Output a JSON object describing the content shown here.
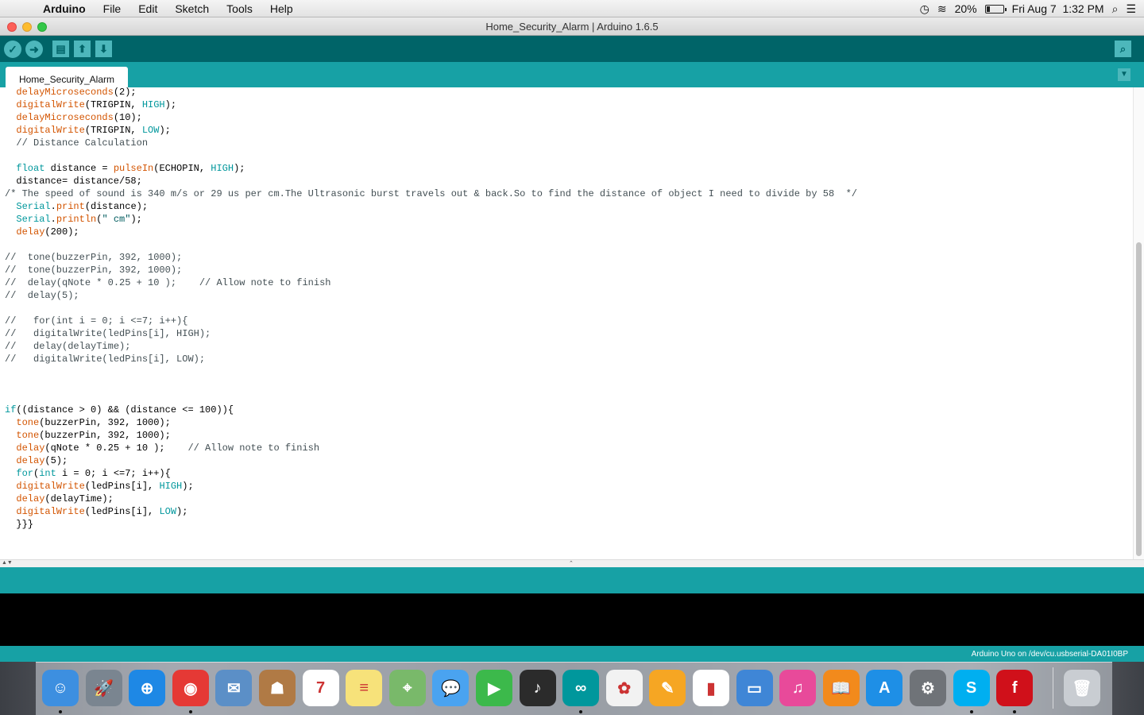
{
  "menubar": {
    "app_name": "Arduino",
    "items": [
      "File",
      "Edit",
      "Sketch",
      "Tools",
      "Help"
    ],
    "battery_percent_label": "20%",
    "battery_level": 0.2,
    "datetime": "Fri Aug 7  1:32 PM"
  },
  "window": {
    "title": "Home_Security_Alarm | Arduino 1.6.5"
  },
  "tab": {
    "label": "Home_Security_Alarm"
  },
  "code_lines": [
    [
      [
        "delayMicroseconds",
        "fn"
      ],
      [
        "(2);",
        ""
      ]
    ],
    [
      [
        "digitalWrite",
        "fn"
      ],
      [
        "(TRIGPIN, ",
        ""
      ],
      [
        "HIGH",
        "kw"
      ],
      [
        ");",
        ""
      ]
    ],
    [
      [
        "delayMicroseconds",
        "fn"
      ],
      [
        "(10);",
        ""
      ]
    ],
    [
      [
        "digitalWrite",
        "fn"
      ],
      [
        "(TRIGPIN, ",
        ""
      ],
      [
        "LOW",
        "kw"
      ],
      [
        ");",
        ""
      ]
    ],
    [
      [
        "// Distance Calculation",
        "cm"
      ]
    ],
    [],
    [
      [
        "float",
        "kw"
      ],
      [
        " distance = ",
        ""
      ],
      [
        "pulseIn",
        "fn"
      ],
      [
        "(ECHOPIN, ",
        ""
      ],
      [
        "HIGH",
        "kw"
      ],
      [
        ");",
        ""
      ]
    ],
    [
      [
        "distance= distance/58;",
        ""
      ]
    ],
    [
      [
        "/* The speed of sound is 340 m/s or 29 us per cm.The Ultrasonic burst travels out & back.So to find the distance of object I need to divide by 58  */",
        "cm"
      ]
    ],
    [
      [
        "Serial",
        "kw"
      ],
      [
        ".",
        ""
      ],
      [
        "print",
        "fn"
      ],
      [
        "(distance);",
        ""
      ]
    ],
    [
      [
        "Serial",
        "kw"
      ],
      [
        ".",
        ""
      ],
      [
        "println",
        "fn"
      ],
      [
        "(",
        ""
      ],
      [
        "\" cm\"",
        "st"
      ],
      [
        ");",
        ""
      ]
    ],
    [
      [
        "delay",
        "fn"
      ],
      [
        "(200);",
        ""
      ]
    ],
    [],
    [
      [
        "//  tone(buzzerPin, 392, 1000);",
        "cm"
      ]
    ],
    [
      [
        "//  tone(buzzerPin, 392, 1000);",
        "cm"
      ]
    ],
    [
      [
        "//  delay(qNote * 0.25 + 10 );    // Allow note to finish",
        "cm"
      ]
    ],
    [
      [
        "//  delay(5);",
        "cm"
      ]
    ],
    [],
    [
      [
        "//   for(int i = 0; i <=7; i++){",
        "cm"
      ]
    ],
    [
      [
        "//   digitalWrite(ledPins[i], HIGH);",
        "cm"
      ]
    ],
    [
      [
        "//   delay(delayTime);",
        "cm"
      ]
    ],
    [
      [
        "//   digitalWrite(ledPins[i], LOW);",
        "cm"
      ]
    ],
    [],
    [],
    [],
    [
      [
        "if",
        "kw"
      ],
      [
        "((distance > 0) && (distance <= 100)){",
        ""
      ]
    ],
    [
      [
        "tone",
        "fn"
      ],
      [
        "(buzzerPin, 392, 1000);",
        ""
      ]
    ],
    [
      [
        "tone",
        "fn"
      ],
      [
        "(buzzerPin, 392, 1000);",
        ""
      ]
    ],
    [
      [
        "delay",
        "fn"
      ],
      [
        "(qNote * 0.25 + 10 );    ",
        ""
      ],
      [
        "// Allow note to finish",
        "cm"
      ]
    ],
    [
      [
        "delay",
        "fn"
      ],
      [
        "(5);",
        ""
      ]
    ],
    [
      [
        "for",
        "kw"
      ],
      [
        "(",
        ""
      ],
      [
        "int",
        "kw"
      ],
      [
        " i = 0; i <=7; i++){",
        ""
      ]
    ],
    [
      [
        "digitalWrite",
        "fn"
      ],
      [
        "(ledPins[i], ",
        ""
      ],
      [
        "HIGH",
        "kw"
      ],
      [
        ");",
        ""
      ]
    ],
    [
      [
        "delay",
        "fn"
      ],
      [
        "(delayTime);",
        ""
      ]
    ],
    [
      [
        "digitalWrite",
        "fn"
      ],
      [
        "(ledPins[i], ",
        ""
      ],
      [
        "LOW",
        "kw"
      ],
      [
        ");",
        ""
      ]
    ],
    [
      [
        "}}}",
        ""
      ]
    ]
  ],
  "code_indent": [
    2,
    2,
    2,
    2,
    2,
    0,
    2,
    2,
    0,
    2,
    2,
    2,
    0,
    0,
    0,
    0,
    0,
    0,
    0,
    0,
    0,
    0,
    0,
    0,
    0,
    0,
    2,
    2,
    2,
    2,
    2,
    2,
    2,
    2,
    2
  ],
  "footer": {
    "board_status": "Arduino Uno on /dev/cu.usbserial-DA01I0BP"
  },
  "dock": {
    "apps": [
      {
        "name": "finder",
        "color": "#3d8fe0",
        "glyph": "☺",
        "running": true
      },
      {
        "name": "launchpad",
        "color": "#7a8590",
        "glyph": "🚀",
        "running": false
      },
      {
        "name": "safari",
        "color": "#1e88e5",
        "glyph": "⊕",
        "running": false
      },
      {
        "name": "chrome",
        "color": "#e53935",
        "glyph": "◉",
        "running": true
      },
      {
        "name": "mail",
        "color": "#5b8fc7",
        "glyph": "✉",
        "running": false
      },
      {
        "name": "contacts",
        "color": "#b07a45",
        "glyph": "☗",
        "running": false
      },
      {
        "name": "calendar",
        "color": "#ffffff",
        "glyph": "7",
        "running": false
      },
      {
        "name": "notes",
        "color": "#f7e27a",
        "glyph": "≡",
        "running": false
      },
      {
        "name": "maps",
        "color": "#79b96a",
        "glyph": "⌖",
        "running": false
      },
      {
        "name": "messages",
        "color": "#4aa3f0",
        "glyph": "💬",
        "running": false
      },
      {
        "name": "facetime",
        "color": "#3cb94b",
        "glyph": "▶",
        "running": false
      },
      {
        "name": "dashboard",
        "color": "#2b2b2b",
        "glyph": "♪",
        "running": false
      },
      {
        "name": "arduino",
        "color": "#00979c",
        "glyph": "∞",
        "running": true
      },
      {
        "name": "photos",
        "color": "#f2f2f2",
        "glyph": "✿",
        "running": false
      },
      {
        "name": "pages",
        "color": "#f6a623",
        "glyph": "✎",
        "running": false
      },
      {
        "name": "numbers",
        "color": "#ffffff",
        "glyph": "▮",
        "running": false
      },
      {
        "name": "keynote",
        "color": "#3f86d6",
        "glyph": "▭",
        "running": false
      },
      {
        "name": "itunes",
        "color": "#e84a9a",
        "glyph": "♫",
        "running": false
      },
      {
        "name": "ibooks",
        "color": "#f28a1c",
        "glyph": "📖",
        "running": false
      },
      {
        "name": "app-store",
        "color": "#1e8fe6",
        "glyph": "A",
        "running": false
      },
      {
        "name": "system-preferences",
        "color": "#6f7378",
        "glyph": "⚙",
        "running": false
      },
      {
        "name": "skype",
        "color": "#00aff0",
        "glyph": "S",
        "running": true
      },
      {
        "name": "fritzing",
        "color": "#d0101a",
        "glyph": "f",
        "running": true
      }
    ],
    "trash": {
      "name": "trash",
      "color": "#c9cdd2",
      "glyph": "🗑"
    }
  }
}
